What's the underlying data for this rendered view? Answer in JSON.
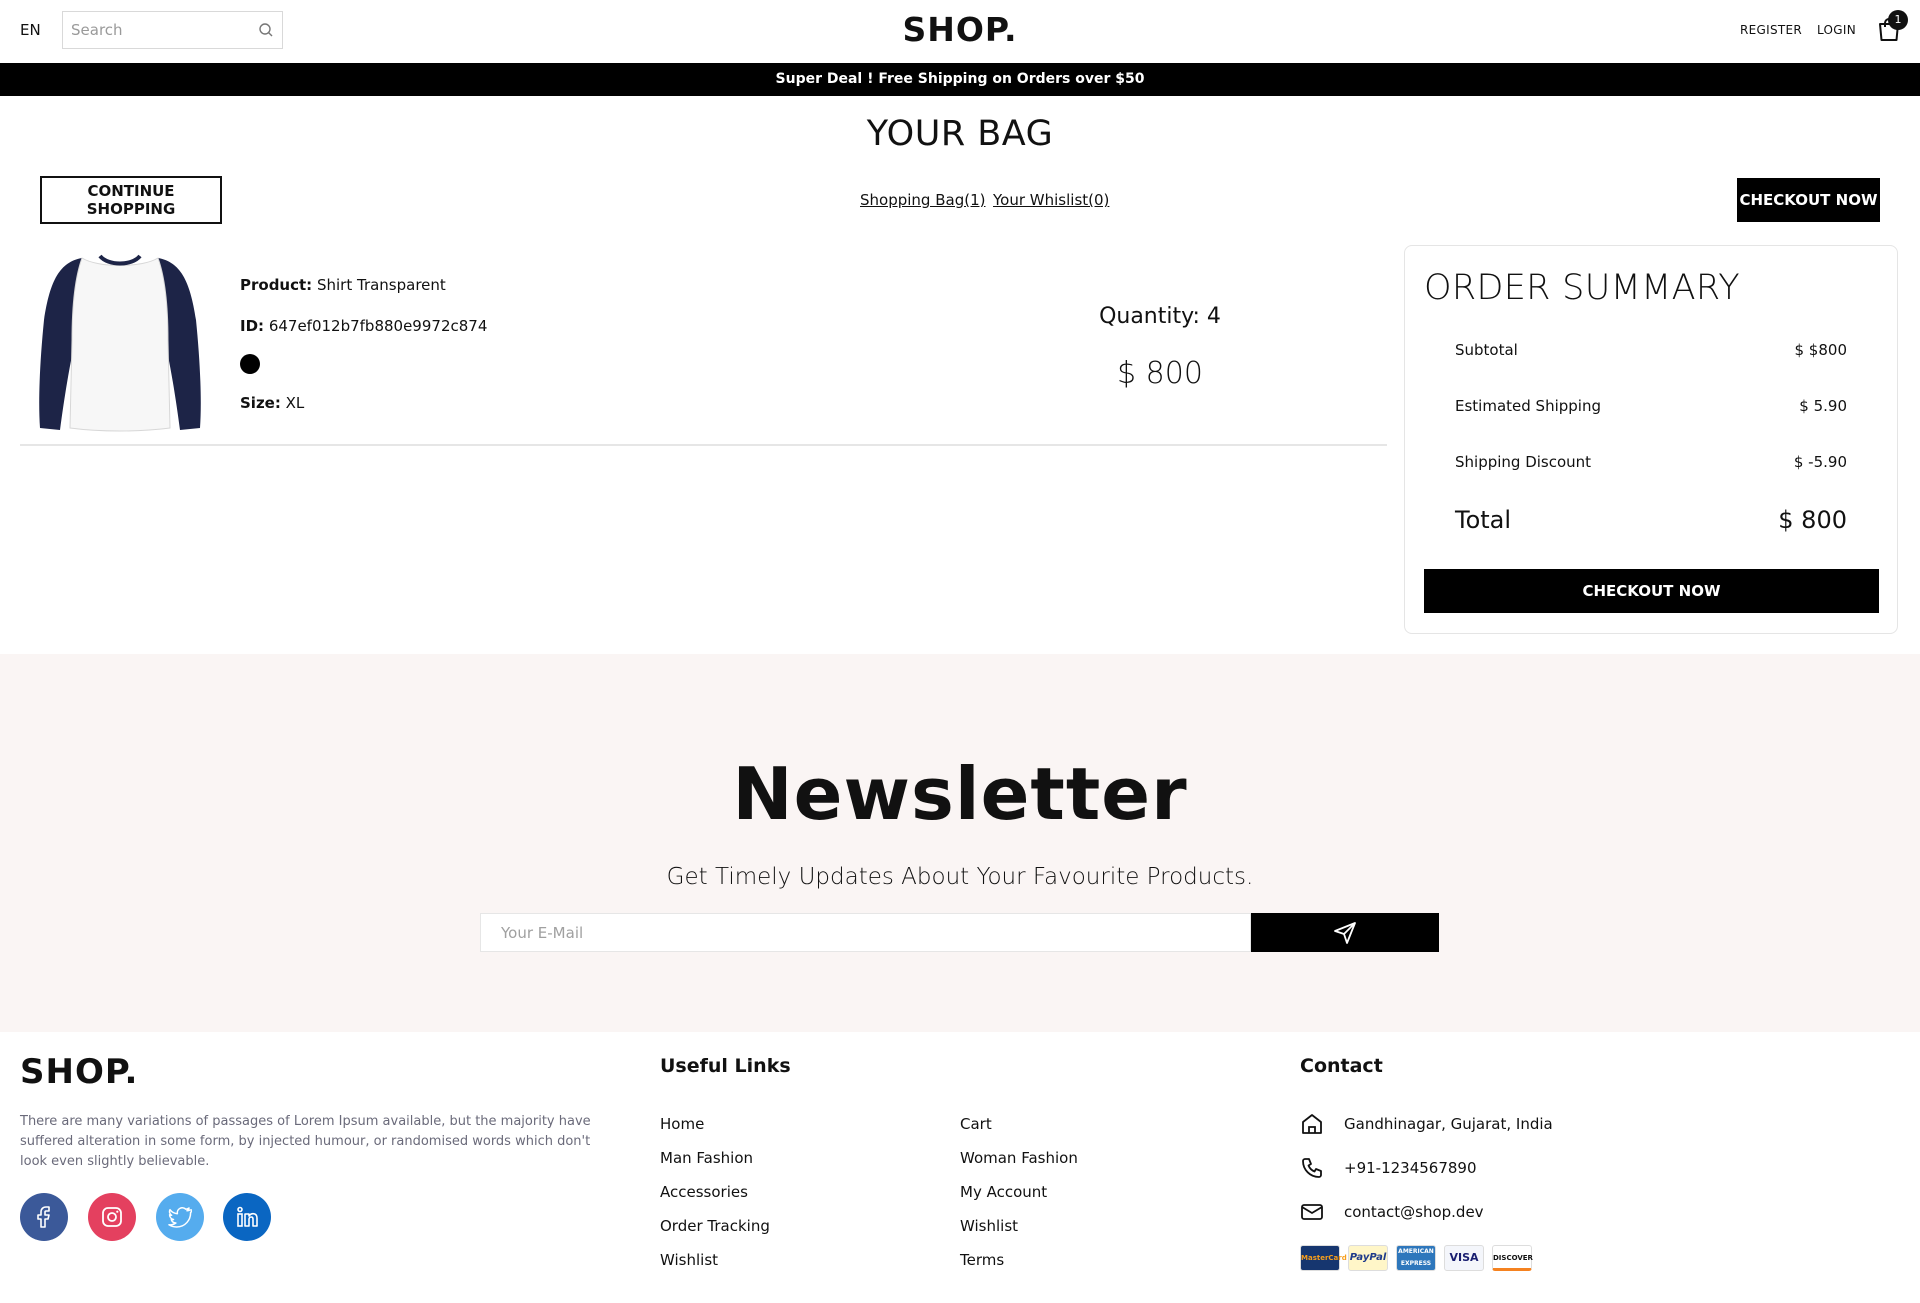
{
  "header": {
    "lang": "EN",
    "search_placeholder": "Search",
    "logo": "SHOP.",
    "register": "REGISTER",
    "login": "LOGIN",
    "cart_count": "1"
  },
  "announcement": "Super Deal ! Free Shipping on Orders over $50",
  "bag": {
    "title": "YOUR BAG",
    "continue_label": "CONTINUE SHOPPING",
    "shopping_bag_link": "Shopping Bag(1)",
    "wishlist_link": "Your Whislist(0)",
    "checkout_label": "CHECKOUT NOW",
    "item": {
      "product_label": "Product:",
      "product_name": "Shirt Transparent",
      "id_label": "ID:",
      "id_value": "647ef012b7fb880e9972c874",
      "color": "#000000",
      "size_label": "Size:",
      "size_value": "XL",
      "quantity": "Quantity: 4",
      "price": "$ 800"
    }
  },
  "summary": {
    "title": "ORDER SUMMARY",
    "rows": [
      {
        "label": "Subtotal",
        "value": "$ $800"
      },
      {
        "label": "Estimated Shipping",
        "value": "$ 5.90"
      },
      {
        "label": "Shipping Discount",
        "value": "$ -5.90"
      }
    ],
    "total_label": "Total",
    "total_value": "$ 800",
    "checkout_label": "CHECKOUT NOW"
  },
  "newsletter": {
    "title": "Newsletter",
    "subtitle": "Get Timely Updates About Your Favourite Products.",
    "email_placeholder": "Your E-Mail"
  },
  "footer": {
    "logo": "SHOP.",
    "description": "There are many variations of passages of Lorem Ipsum available, but the majority have suffered alteration in some form, by injected humour, or randomised words which don't look even slightly believable.",
    "social": [
      {
        "icon": "facebook-icon",
        "color": "#3b5999"
      },
      {
        "icon": "instagram-icon",
        "color": "#e4405f"
      },
      {
        "icon": "twitter-icon",
        "color": "#55acee"
      },
      {
        "icon": "linkedin-icon",
        "color": "#0a66c2"
      }
    ],
    "links_title": "Useful Links",
    "links_col1": [
      "Home",
      "Man Fashion",
      "Accessories",
      "Order Tracking",
      "Wishlist"
    ],
    "links_col2": [
      "Cart",
      "Woman Fashion",
      "My Account",
      "Wishlist",
      "Terms"
    ],
    "contact_title": "Contact",
    "address": "Gandhinagar, Gujarat, India",
    "phone": "+91-1234567890",
    "email": "contact@shop.dev",
    "payments": [
      "MasterCard",
      "PayPal",
      "AMERICAN EXPRESS",
      "VISA",
      "DISCOVER"
    ]
  }
}
